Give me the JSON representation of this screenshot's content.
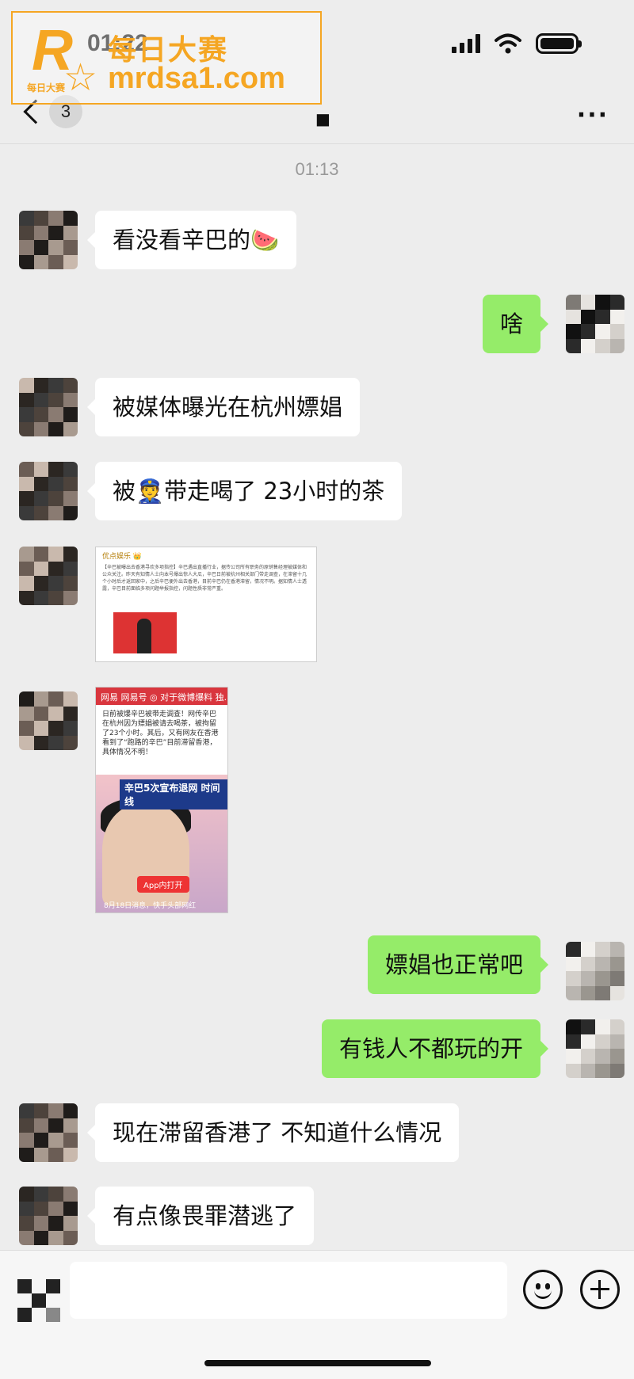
{
  "status_bar": {
    "time": "01:22"
  },
  "watermark": {
    "logo_letter": "R",
    "logo_small": "每日大赛",
    "cn_text": "每日大赛",
    "url": "mrdsa1.com"
  },
  "header": {
    "unread_count": "3",
    "title": "■",
    "more": "···"
  },
  "chat": {
    "timestamp": "01:13",
    "messages": [
      {
        "side": "in",
        "text": "看没看辛巴的🍉"
      },
      {
        "side": "out",
        "text": "啥"
      },
      {
        "side": "in",
        "text": "被媒体曝光在杭州嫖娼"
      },
      {
        "side": "in",
        "text": "被👮带走喝了 23小时的茶"
      },
      {
        "side": "in",
        "type": "image",
        "image_header": "优点娱乐 👑",
        "image_text": "【辛巴被曝出去香港寻欢多项指控】辛巴遇出直播行业，据传公司所有职务的原销售经理被媒体和公众关注。昨天有知情人士向本号爆出惊人大瓜，辛巴日前被杭州相关部门带走调查，在滞留十几个小时后才返回家中，之后辛巴便外出去香港，目前辛巴仍在香港滞留，情况不明。据知情人士透露，辛巴目前面临多项问题举报指控，问题性质非常严重。"
      },
      {
        "side": "in",
        "type": "image",
        "image_topbar": "网易 网易号 ◎ 对于微博爆料 独...",
        "image_text": "日前被爆辛巴被带走调查！网传辛巴在杭州因为嫖娼被请去喝茶，被拘留了23个小时。其后，又有网友在香港看到了“跑路的辛巴”目前滞留香港，具体情况不明！",
        "banner_title": "辛巴5次宣布退网 时间线",
        "app_button": "App内打开",
        "caption": "8月18日消息，快手头部网红"
      },
      {
        "side": "out",
        "text": "嫖娼也正常吧"
      },
      {
        "side": "out",
        "text": "有钱人不都玩的开"
      },
      {
        "side": "in",
        "text": "现在滞留香港了 不知道什么情况"
      },
      {
        "side": "in",
        "text": "有点像畏罪潜逃了"
      }
    ]
  },
  "input": {
    "value": ""
  },
  "colors": {
    "outgoing_bubble": "#95ec69",
    "incoming_bubble": "#ffffff",
    "background": "#ededed",
    "watermark": "#f5a623"
  }
}
